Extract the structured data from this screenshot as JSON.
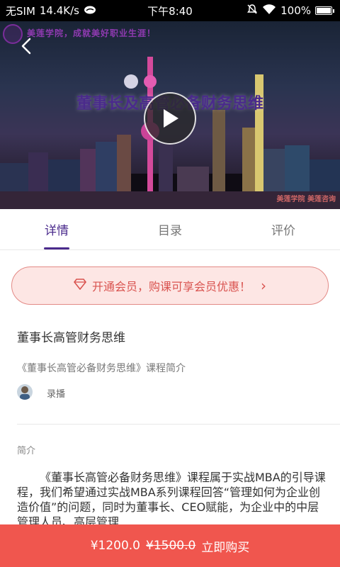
{
  "status_bar": {
    "carrier": "无SIM",
    "speed": "14.4K/s",
    "time": "下午8:40",
    "battery": "100%",
    "icons": [
      "cloud-icon",
      "mute-icon",
      "wifi-icon",
      "battery-icon"
    ]
  },
  "banner": {
    "brand_text": "美莲学院，成就美好职业生涯！",
    "title_overlay": "董事长及高管必备财务思维",
    "watermark": "美莲学院 美莲咨询",
    "icons": [
      "back-icon",
      "play-icon"
    ]
  },
  "tabs": [
    {
      "label": "详情",
      "active": true
    },
    {
      "label": "目录",
      "active": false
    },
    {
      "label": "评价",
      "active": false
    }
  ],
  "vip": {
    "text": "开通会员，购课可享会员优惠！",
    "icon": "diamond-icon",
    "chevron": "›",
    "colors": {
      "border": "#e38a86",
      "background": "#fde6e4",
      "text": "#d9534f"
    }
  },
  "course": {
    "title": "董事长高管财务思维",
    "subtitle": "《董事长高管必备财务思维》课程简介",
    "record_label": "录播",
    "intro_label": "简介",
    "intro_text": "《董事长高管必备财务思维》课程属于实战MBA的引导课程，我们希望通过实战MBA系列课程回答“管理如何为企业创造价值”的问题，同时为董事长、CEO赋能，为企业中的中层管理人员、高层管理"
  },
  "buy": {
    "price": "¥1200.0",
    "original_price": "¥1500.0",
    "action": "立即购买",
    "color": "#f0564e"
  },
  "accent_color": "#4a2a8c"
}
